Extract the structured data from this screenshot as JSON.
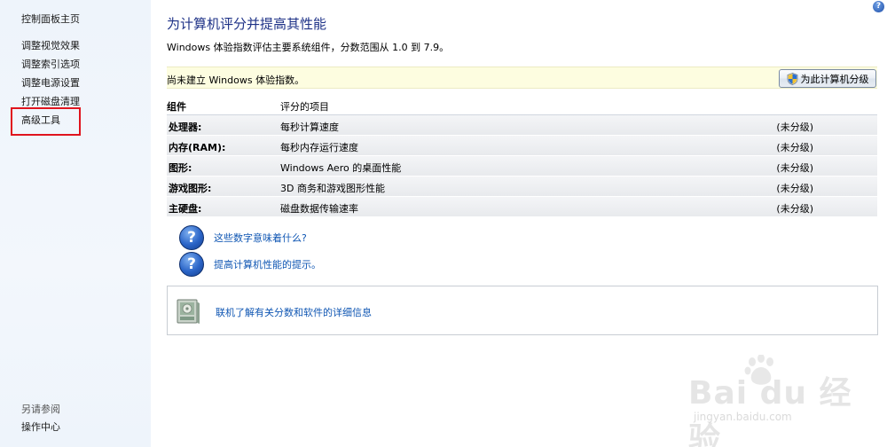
{
  "sidebar": {
    "home": "控制面板主页",
    "links": [
      {
        "label": "调整视觉效果"
      },
      {
        "label": "调整索引选项"
      },
      {
        "label": "调整电源设置"
      },
      {
        "label": "打开磁盘清理"
      },
      {
        "label": "高级工具"
      }
    ],
    "see_also": "另请参阅",
    "action_center": "操作中心"
  },
  "header": {
    "help_icon": "?",
    "title": "为计算机评分并提高其性能",
    "subtitle": "Windows 体验指数评估主要系统组件，分数范围从 1.0 到 7.9。"
  },
  "notice": {
    "text": "尚未建立 Windows 体验指数。",
    "button_label": "为此计算机分级",
    "button_icon": "uac-shield-icon"
  },
  "table": {
    "headers": {
      "component": "组件",
      "rated": "评分的项目"
    },
    "rows": [
      {
        "component": "处理器:",
        "item": "每秒计算速度",
        "score": "(未分级)"
      },
      {
        "component": "内存(RAM):",
        "item": "每秒内存运行速度",
        "score": "(未分级)"
      },
      {
        "component": "图形:",
        "item": "Windows Aero 的桌面性能",
        "score": "(未分级)"
      },
      {
        "component": "游戏图形:",
        "item": "3D 商务和游戏图形性能",
        "score": "(未分级)"
      },
      {
        "component": "主硬盘:",
        "item": "磁盘数据传输速率",
        "score": "(未分级)"
      }
    ]
  },
  "help_links": {
    "icon_glyph": "?",
    "meaning": "这些数字意味着什么?",
    "tips": "提高计算机性能的提示。"
  },
  "online": {
    "link": "联机了解有关分数和软件的详细信息"
  },
  "watermark": {
    "text": "Bai du 经验",
    "url": "jingyan.baidu.com"
  },
  "colors": {
    "title": "#1e3287",
    "link": "#0f56b3",
    "notice_bg": "#fdfde0",
    "highlight": "#e0141e"
  }
}
